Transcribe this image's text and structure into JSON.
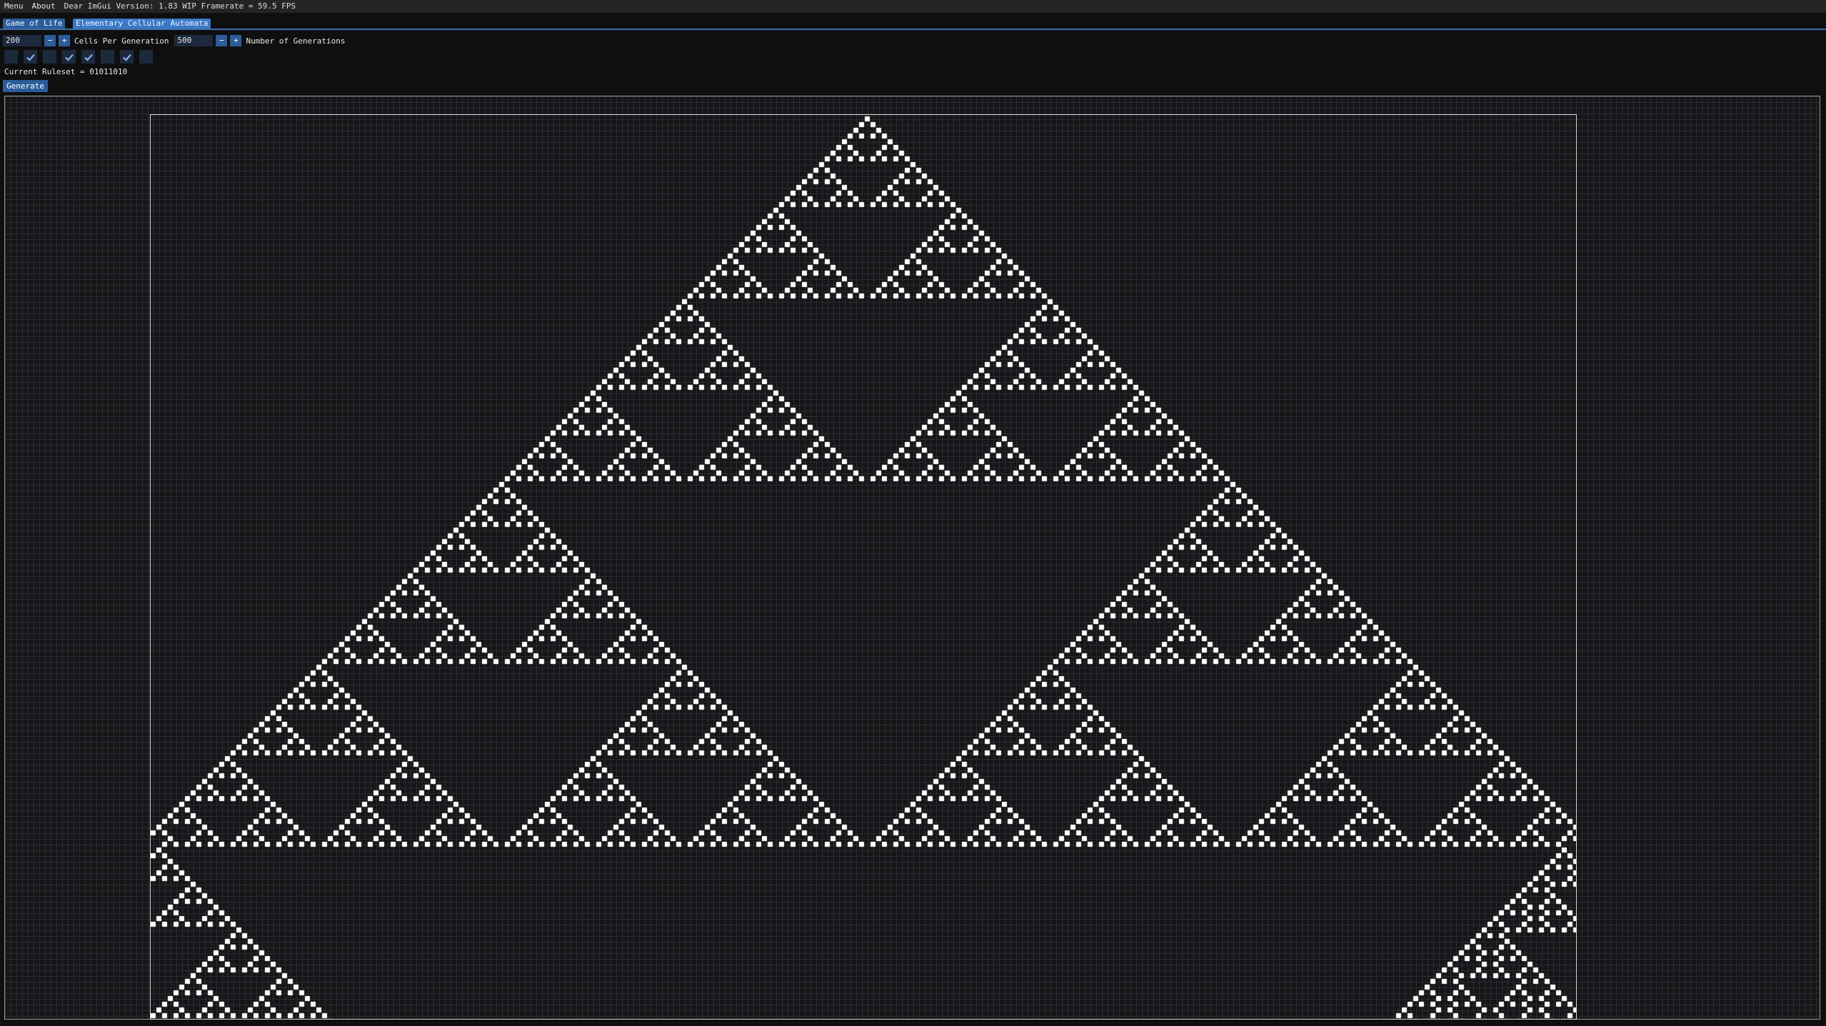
{
  "menubar": {
    "items": [
      "Menu",
      "About"
    ],
    "info": "Dear ImGui Version: 1.83 WIP Framerate = 59.5 FPS"
  },
  "tabs": [
    {
      "label": "Game of Life",
      "active": false
    },
    {
      "label": "Elementary Cellular Automata",
      "active": true
    }
  ],
  "controls": {
    "cells_value": "200",
    "cells_label": "Cells Per Generation",
    "generations_value": "500",
    "generations_label": "Number of Generations",
    "minus": "−",
    "plus": "+"
  },
  "rule_bits": [
    false,
    true,
    false,
    true,
    true,
    false,
    true,
    false
  ],
  "ruleset_text": "Current Ruleset = 01011010",
  "generate_label": "Generate",
  "colors": {
    "accent": "#3a79c7",
    "button": "#2b5d9a",
    "frame_bg": "#1d2a3d",
    "cell_alive": "#ffffff",
    "cell_dead": "#151618"
  }
}
